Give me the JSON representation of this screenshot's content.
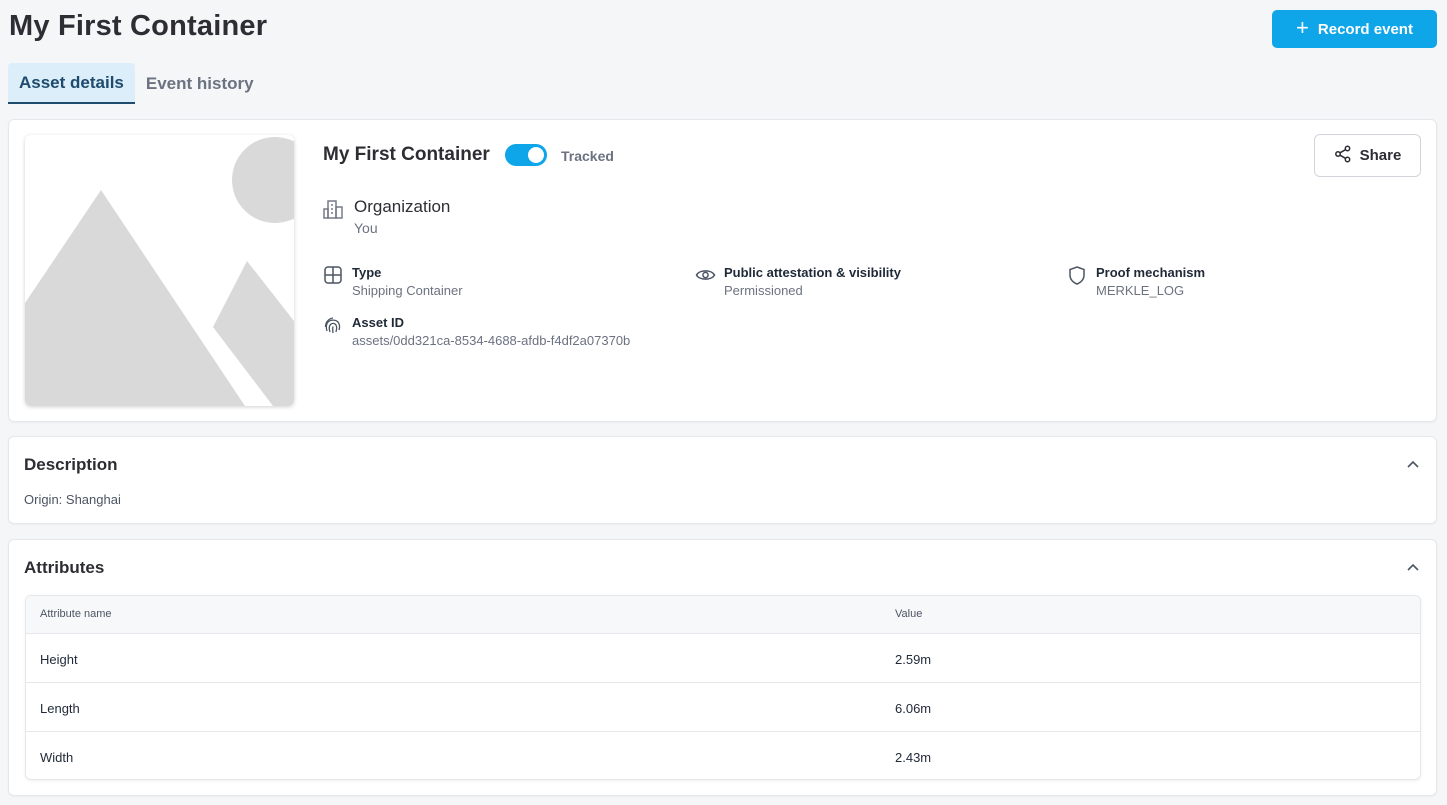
{
  "header": {
    "title": "My First Container",
    "record_button": "Record event"
  },
  "tabs": [
    {
      "label": "Asset details",
      "active": true
    },
    {
      "label": "Event history",
      "active": false
    }
  ],
  "asset": {
    "name": "My First Container",
    "tracked_label": "Tracked",
    "tracked_on": true,
    "share_label": "Share",
    "organization": {
      "title": "Organization",
      "value": "You"
    },
    "fields": {
      "type": {
        "label": "Type",
        "value": "Shipping Container"
      },
      "visibility": {
        "label": "Public attestation & visibility",
        "value": "Permissioned"
      },
      "proof": {
        "label": "Proof mechanism",
        "value": "MERKLE_LOG"
      },
      "asset_id": {
        "label": "Asset ID",
        "value": "assets/0dd321ca-8534-4688-afdb-f4df2a07370b"
      }
    }
  },
  "description": {
    "title": "Description",
    "text": "Origin: Shanghai"
  },
  "attributes": {
    "title": "Attributes",
    "columns": [
      "Attribute name",
      "Value"
    ],
    "rows": [
      {
        "name": "Height",
        "value": "2.59m"
      },
      {
        "name": "Length",
        "value": "6.06m"
      },
      {
        "name": "Width",
        "value": "2.43m"
      }
    ]
  },
  "colors": {
    "accent": "#0ea5e9",
    "tab_active_bg": "#dbeefa",
    "tab_active_text": "#1e4b6e"
  }
}
